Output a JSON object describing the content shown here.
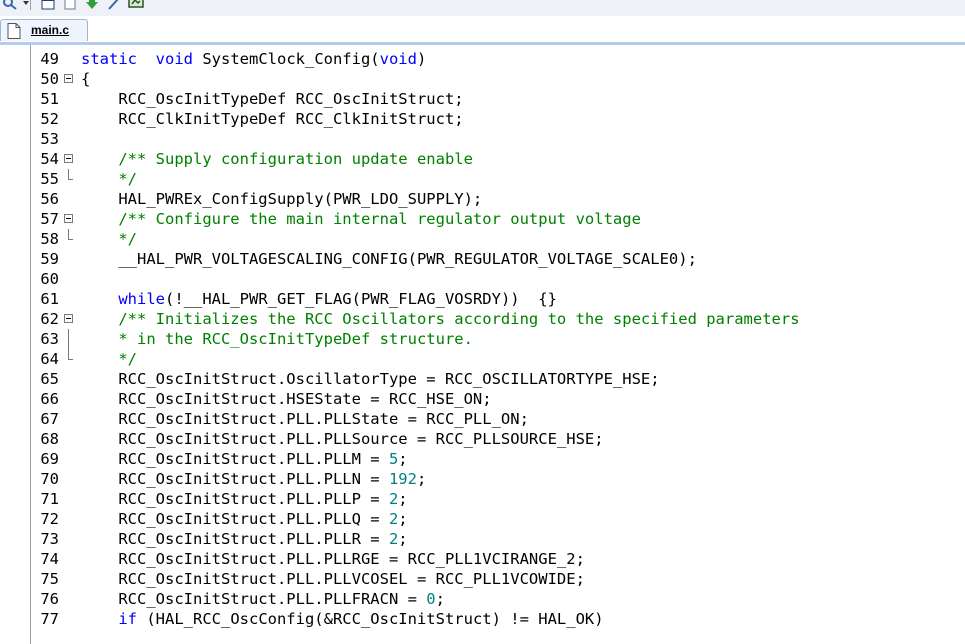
{
  "toolbar": {
    "buttons": [
      {
        "icon": "magnifier-icon"
      },
      {
        "icon": "window-icon"
      },
      {
        "icon": "blank-window-icon"
      },
      {
        "icon": "down-arrow-icon"
      },
      {
        "icon": "wand-icon"
      },
      {
        "icon": "monitor-icon"
      }
    ]
  },
  "tab": {
    "label": "main.c",
    "icon": "file-icon"
  },
  "colors": {
    "keyword": "#0000ff",
    "comment": "#008000",
    "number": "#008080",
    "text": "#000000"
  },
  "lines": [
    {
      "n": "49",
      "fold": "",
      "tokens": [
        [
          "kw",
          "static"
        ],
        [
          "",
          "  "
        ],
        [
          "kw",
          "void"
        ],
        [
          "",
          " SystemClock_Config("
        ],
        [
          "kw",
          "void"
        ],
        [
          "",
          ")"
        ]
      ]
    },
    {
      "n": "50",
      "fold": "open",
      "tokens": [
        [
          "",
          "{"
        ]
      ]
    },
    {
      "n": "51",
      "fold": "",
      "tokens": [
        [
          "",
          "    RCC_OscInitTypeDef RCC_OscInitStruct;"
        ]
      ]
    },
    {
      "n": "52",
      "fold": "",
      "tokens": [
        [
          "",
          "    RCC_ClkInitTypeDef RCC_ClkInitStruct;"
        ]
      ]
    },
    {
      "n": "53",
      "fold": "",
      "tokens": []
    },
    {
      "n": "54",
      "fold": "open",
      "tokens": [
        [
          "cm",
          "    /** Supply configuration update enable"
        ]
      ]
    },
    {
      "n": "55",
      "fold": "end",
      "tokens": [
        [
          "cm",
          "    */"
        ]
      ]
    },
    {
      "n": "56",
      "fold": "",
      "tokens": [
        [
          "",
          "    HAL_PWREx_ConfigSupply(PWR_LDO_SUPPLY);"
        ]
      ]
    },
    {
      "n": "57",
      "fold": "open",
      "tokens": [
        [
          "cm",
          "    /** Configure the main internal regulator output voltage"
        ]
      ]
    },
    {
      "n": "58",
      "fold": "end",
      "tokens": [
        [
          "cm",
          "    */"
        ]
      ]
    },
    {
      "n": "59",
      "fold": "",
      "tokens": [
        [
          "",
          "    __HAL_PWR_VOLTAGESCALING_CONFIG(PWR_REGULATOR_VOLTAGE_SCALE0);"
        ]
      ]
    },
    {
      "n": "60",
      "fold": "",
      "tokens": []
    },
    {
      "n": "61",
      "fold": "",
      "tokens": [
        [
          "kw",
          "    while"
        ],
        [
          "",
          "(!__HAL_PWR_GET_FLAG(PWR_FLAG_VOSRDY))  {}"
        ]
      ]
    },
    {
      "n": "62",
      "fold": "open",
      "tokens": [
        [
          "cm",
          "    /** Initializes the RCC Oscillators according to the specified parameters"
        ]
      ]
    },
    {
      "n": "63",
      "fold": "vline",
      "tokens": [
        [
          "cm",
          "    * in the RCC_OscInitTypeDef structure."
        ]
      ]
    },
    {
      "n": "64",
      "fold": "end",
      "tokens": [
        [
          "cm",
          "    */"
        ]
      ]
    },
    {
      "n": "65",
      "fold": "",
      "tokens": [
        [
          "",
          "    RCC_OscInitStruct.OscillatorType = RCC_OSCILLATORTYPE_HSE;"
        ]
      ]
    },
    {
      "n": "66",
      "fold": "",
      "tokens": [
        [
          "",
          "    RCC_OscInitStruct.HSEState = RCC_HSE_ON;"
        ]
      ]
    },
    {
      "n": "67",
      "fold": "",
      "tokens": [
        [
          "",
          "    RCC_OscInitStruct.PLL.PLLState = RCC_PLL_ON;"
        ]
      ]
    },
    {
      "n": "68",
      "fold": "",
      "tokens": [
        [
          "",
          "    RCC_OscInitStruct.PLL.PLLSource = RCC_PLLSOURCE_HSE;"
        ]
      ]
    },
    {
      "n": "69",
      "fold": "",
      "tokens": [
        [
          "",
          "    RCC_OscInitStruct.PLL.PLLM = "
        ],
        [
          "num",
          "5"
        ],
        [
          "",
          ";"
        ]
      ]
    },
    {
      "n": "70",
      "fold": "",
      "tokens": [
        [
          "",
          "    RCC_OscInitStruct.PLL.PLLN = "
        ],
        [
          "num",
          "192"
        ],
        [
          "",
          ";"
        ]
      ]
    },
    {
      "n": "71",
      "fold": "",
      "tokens": [
        [
          "",
          "    RCC_OscInitStruct.PLL.PLLP = "
        ],
        [
          "num",
          "2"
        ],
        [
          "",
          ";"
        ]
      ]
    },
    {
      "n": "72",
      "fold": "",
      "tokens": [
        [
          "",
          "    RCC_OscInitStruct.PLL.PLLQ = "
        ],
        [
          "num",
          "2"
        ],
        [
          "",
          ";"
        ]
      ]
    },
    {
      "n": "73",
      "fold": "",
      "tokens": [
        [
          "",
          "    RCC_OscInitStruct.PLL.PLLR = "
        ],
        [
          "num",
          "2"
        ],
        [
          "",
          ";"
        ]
      ]
    },
    {
      "n": "74",
      "fold": "",
      "tokens": [
        [
          "",
          "    RCC_OscInitStruct.PLL.PLLRGE = RCC_PLL1VCIRANGE_2;"
        ]
      ]
    },
    {
      "n": "75",
      "fold": "",
      "tokens": [
        [
          "",
          "    RCC_OscInitStruct.PLL.PLLVCOSEL = RCC_PLL1VCOWIDE;"
        ]
      ]
    },
    {
      "n": "76",
      "fold": "",
      "tokens": [
        [
          "",
          "    RCC_OscInitStruct.PLL.PLLFRACN = "
        ],
        [
          "num",
          "0"
        ],
        [
          "",
          ";"
        ]
      ]
    },
    {
      "n": "77",
      "fold": "",
      "tokens": [
        [
          "kw",
          "    if"
        ],
        [
          "",
          " (HAL_RCC_OscConfig(&RCC_OscInitStruct) != HAL_OK)"
        ]
      ]
    }
  ]
}
